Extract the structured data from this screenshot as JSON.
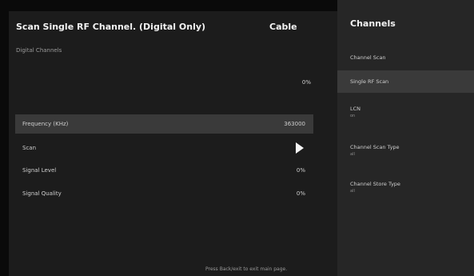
{
  "main": {
    "title": "Scan Single RF Channel. (Digital Only)",
    "source": "Cable",
    "section_label": "Digital Channels",
    "progress_value": "0%",
    "rows": [
      {
        "label": "Frequency (KHz)",
        "value": "363000"
      },
      {
        "label": "Scan",
        "icon": "play-icon"
      },
      {
        "label": "Signal Level",
        "value": "0%"
      },
      {
        "label": "Signal Quality",
        "value": "0%"
      }
    ],
    "footer_hint": "Press Back/exit to exit main page."
  },
  "side_menu": {
    "title": "Channels",
    "items": [
      {
        "label": "Channel Scan"
      },
      {
        "label": "Single RF Scan",
        "selected": true
      },
      {
        "label": "LCN",
        "sub": "on"
      },
      {
        "label": "Channel Scan Type",
        "sub": "all"
      },
      {
        "label": "Channel Store Type",
        "sub": "all"
      }
    ]
  },
  "colors": {
    "background": "#0a0a0a",
    "main_panel": "#1c1c1c",
    "side_panel": "#262626",
    "highlight": "#3a3a3a"
  }
}
